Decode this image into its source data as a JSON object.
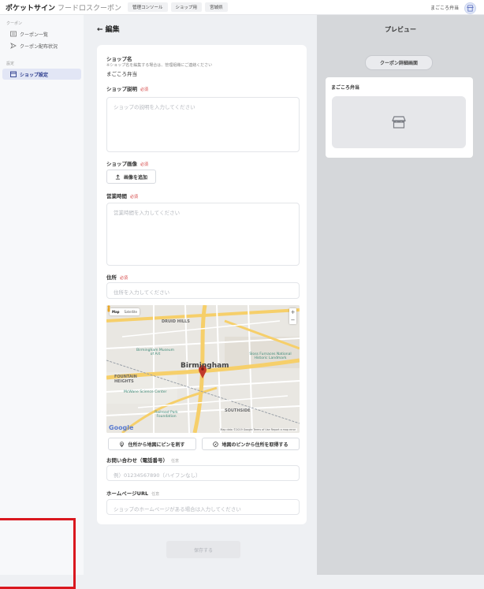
{
  "app": {
    "brand": "ポケットサイン",
    "brand_sub": "フードロスクーポン",
    "tabs": [
      "管理コンソール",
      "ショップ用",
      "宮城県"
    ],
    "store_name": "まごころ弁当"
  },
  "sidebar": {
    "section_coupons": "クーポン",
    "items": [
      {
        "label": "クーポン一覧",
        "icon": "list-icon"
      },
      {
        "label": "クーポン配布状況",
        "icon": "send-icon"
      }
    ],
    "section_settings": "設定",
    "active_item": {
      "label": "ショップ設定",
      "icon": "calendar-icon"
    }
  },
  "page": {
    "title": "← 編集"
  },
  "form": {
    "shop_name_label": "ショップ名",
    "shop_name_note": "※ショップ名を編集する場合は、管理組織にご連絡ください",
    "shop_name_value": "まごころ弁当",
    "description_label": "ショップ説明",
    "description_placeholder": "ショップの説明を入力してください",
    "image_label": "ショップ画像",
    "add_image_button": "画像を追加",
    "hours_label": "営業時間",
    "hours_placeholder": "営業時間を入力してください",
    "address_label": "住所",
    "address_placeholder": "住所を入力してください",
    "pin_from_address_button": "住所から地図にピンを刺す",
    "address_from_pin_button": "地図のピンから住所を取得する",
    "phone_label": "お問い合わせ（電話番号）",
    "phone_placeholder": "例）01234567890（ハイフンなし）",
    "homepage_label": "ホームページURL",
    "homepage_placeholder": "ショップのホームページがある場合は入力してください",
    "required_tag": "必須",
    "optional_tag": "任意",
    "save_button": "保存する"
  },
  "map": {
    "tab_map": "Map",
    "tab_satellite": "Satellite",
    "zoom_in": "+",
    "zoom_out": "−",
    "labels": {
      "druid_hills": "DRUID HILLS",
      "museum": "Birmingham Museum of Art",
      "city": "Birmingham",
      "sloss": "Sloss Furnaces National Historic Landmark",
      "fountain": "FOUNTAIN HEIGHTS",
      "mcwane": "McWane Science Center",
      "railroad": "Railroad Park Foundation",
      "southside": "SOUTHSIDE",
      "google": "Google",
      "attribution": "Map data ©2019 Google  Terms of Use  Report a map error"
    }
  },
  "preview": {
    "title": "プレビュー",
    "pill": "クーポン詳細画面",
    "shop_name": "まごころ弁当",
    "image_icon": "store-icon"
  },
  "colors": {
    "accent": "#2a3a8c",
    "required": "#d23c3c",
    "annotation": "#d9171e"
  }
}
